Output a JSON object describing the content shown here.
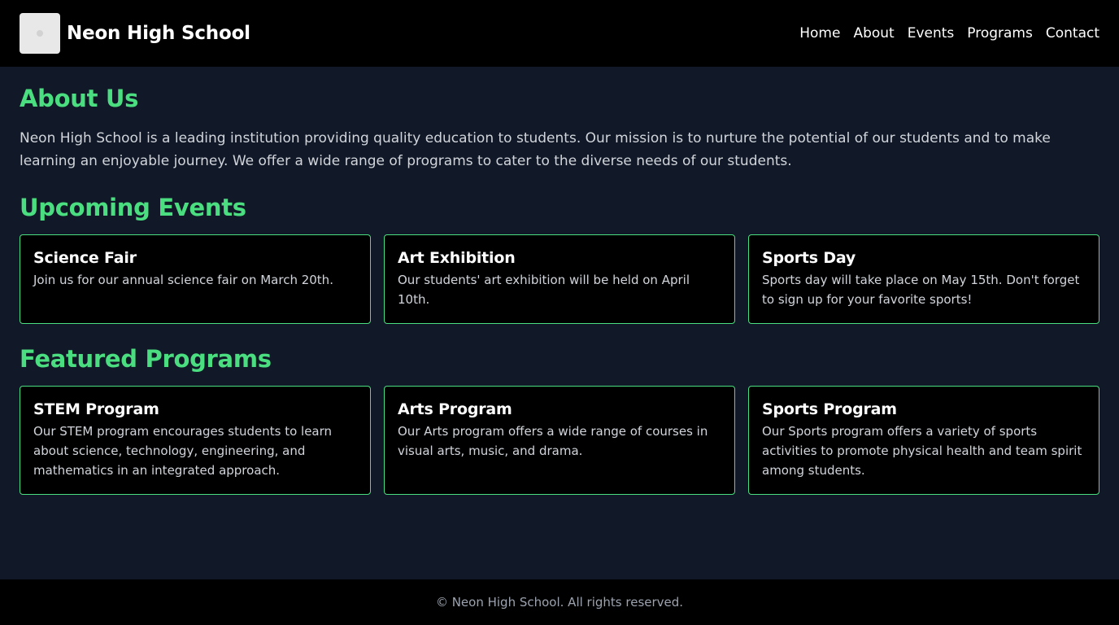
{
  "header": {
    "site_title": "Neon High School",
    "logo_icon": "school-logo-icon",
    "nav": [
      {
        "label": "Home"
      },
      {
        "label": "About"
      },
      {
        "label": "Events"
      },
      {
        "label": "Programs"
      },
      {
        "label": "Contact"
      }
    ]
  },
  "about": {
    "title": "About Us",
    "text": "Neon High School is a leading institution providing quality education to students. Our mission is to nurture the potential of our students and to make learning an enjoyable journey. We offer a wide range of programs to cater to the diverse needs of our students."
  },
  "events": {
    "title": "Upcoming Events",
    "items": [
      {
        "title": "Science Fair",
        "text": "Join us for our annual science fair on March 20th."
      },
      {
        "title": "Art Exhibition",
        "text": "Our students' art exhibition will be held on April 10th."
      },
      {
        "title": "Sports Day",
        "text": "Sports day will take place on May 15th. Don't forget to sign up for your favorite sports!"
      }
    ]
  },
  "programs": {
    "title": "Featured Programs",
    "items": [
      {
        "title": "STEM Program",
        "text": "Our STEM program encourages students to learn about science, technology, engineering, and mathematics in an integrated approach."
      },
      {
        "title": "Arts Program",
        "text": "Our Arts program offers a wide range of courses in visual arts, music, and drama."
      },
      {
        "title": "Sports Program",
        "text": "Our Sports program offers a variety of sports activities to promote physical health and team spirit among students."
      }
    ]
  },
  "footer": {
    "text": "© Neon High School. All rights reserved."
  },
  "colors": {
    "accent": "#4ade80",
    "page_bg": "#111827",
    "header_bg": "#000000",
    "card_bg": "#000000"
  }
}
